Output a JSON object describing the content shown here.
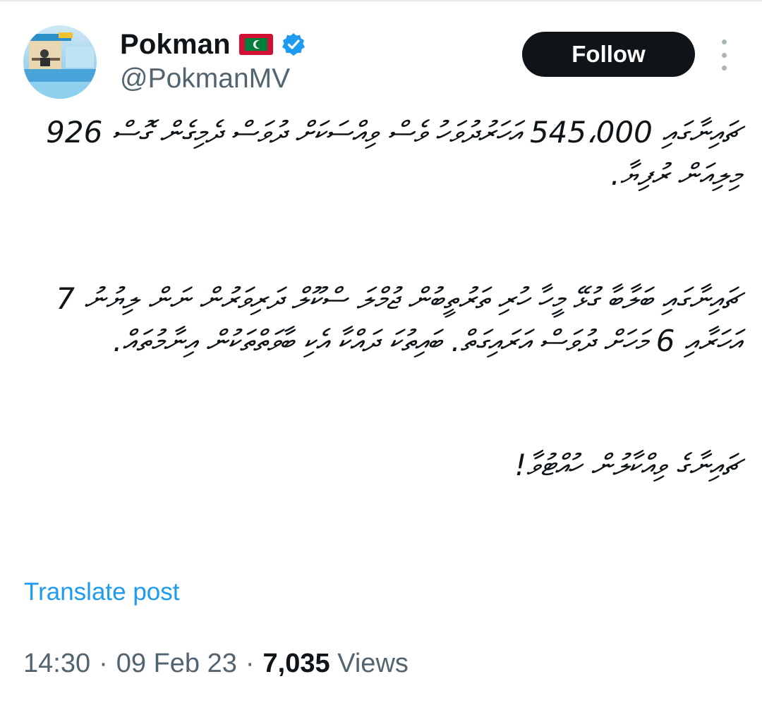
{
  "author": {
    "display_name": "Pokman",
    "handle": "@PokmanMV",
    "flag_icon": "maldives-flag-icon",
    "verified_icon": "verified-badge-icon",
    "avatar_icon": "avatar-photo"
  },
  "actions": {
    "follow_label": "Follow",
    "more_icon": "more-options-icon"
  },
  "post": {
    "paragraphs": [
      "ޗައިނާގައި 545،000 އަހަރުދުވަހު ވެސް ވިއްސަކަށް ދުވަސް ދެމިގެން ގޮސް 926 މިލިއަން ރުފިޔާ.",
      "ޗައިނާގައި ބަލާބާ ގުޅޭ މީހާ ހުރި ތަރުތީބުން ޖުމްލަ ސްކޫލް ދަރިވަރުން ނަން ލިޔުނު 7 އަހަރާއި 6 މަހަށް ދުވަސް އަރައިގަތް. ބައިތުކަ ދައްކާ އެކި ބާވަތްތަކުން އިނާމުތައް.",
      "ޗައިނާގެ ވިއްކާލުން ހުއްޓުވާ!"
    ],
    "translate_label": "Translate post"
  },
  "meta": {
    "time": "14:30",
    "separator": "·",
    "date": "09 Feb 23",
    "views_count": "7,035",
    "views_label": "Views"
  },
  "colors": {
    "text": "#0f1419",
    "secondary": "#536471",
    "accent": "#1d9bf0",
    "follow_bg": "#0f1419",
    "verified": "#1d9bf0"
  }
}
